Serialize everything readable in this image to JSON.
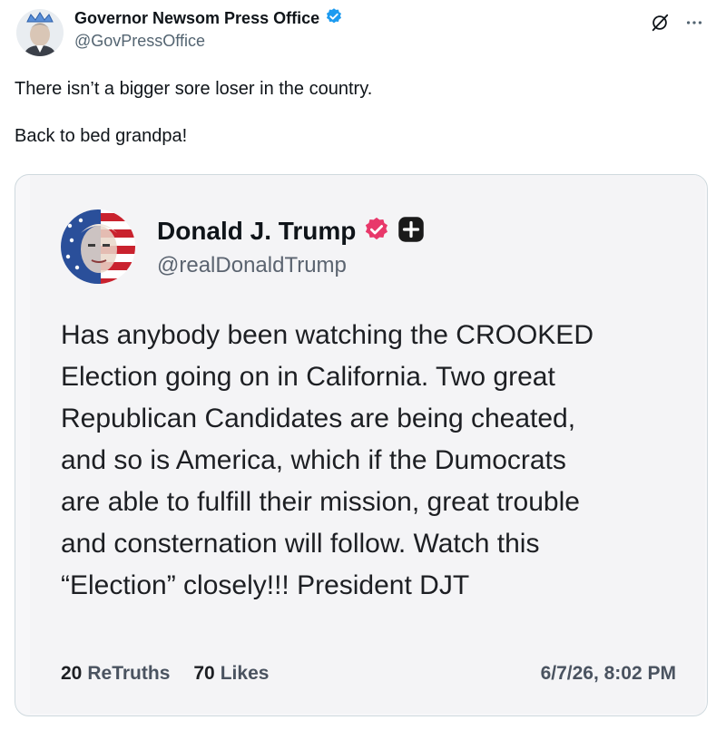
{
  "post": {
    "author_name": "Governor Newsom Press Office",
    "handle": "@GovPressOffice",
    "verified_icon": "verified-badge-icon",
    "actions": {
      "grok_icon": "grok-icon",
      "more_icon": "more-options-icon",
      "more_label": "···"
    },
    "text_lines": [
      "There isn’t a bigger sore loser in the country.",
      "Back to bed grandpa!"
    ]
  },
  "quote": {
    "author_name": "Donald J. Trump",
    "handle": "@realDonaldTrump",
    "verified_icon": "verified-badge-icon",
    "plus_icon": "plus-icon",
    "body_lines": [
      "Has anybody been watching the CROOKED",
      "Election going on in California. Two great",
      "Republican Candidates are being cheated,",
      "and so is America, which if the Dumocrats",
      "are able to fulfill their mission, great trouble",
      "and consternation will follow. Watch this",
      "“Election” closely!!! President DJT"
    ],
    "retruths_count": "20",
    "retruths_label": "ReTruths",
    "likes_count": "70",
    "likes_label": "Likes",
    "date": "6/7/26, 8:02 PM"
  },
  "colors": {
    "verified_blue": "#1d9bf0",
    "truth_badge_pink": "#e8386a",
    "text_primary": "#0f1419",
    "text_secondary": "#536471",
    "card_border": "#cfd9de",
    "card_background": "#f4f4f6"
  }
}
